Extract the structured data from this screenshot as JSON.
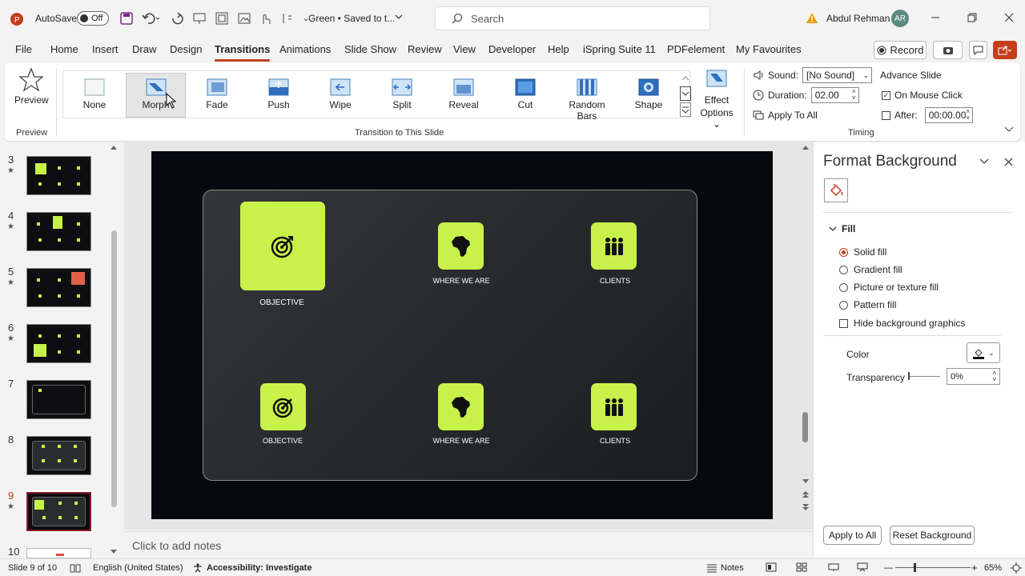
{
  "titlebar": {
    "autosave_label": "AutoSave",
    "autosave_state": "Off",
    "doc_title": "Green • Saved to t...",
    "search_placeholder": "Search",
    "user_name": "Abdul Rehman",
    "user_initials": "AR"
  },
  "tabs": [
    "File",
    "Home",
    "Insert",
    "Draw",
    "Design",
    "Transitions",
    "Animations",
    "Slide Show",
    "Review",
    "View",
    "Developer",
    "Help",
    "iSpring Suite 11",
    "PDFelement",
    "My Favourites"
  ],
  "active_tab": "Transitions",
  "record_label": "Record",
  "ribbon": {
    "preview_label": "Preview",
    "preview_group": "Preview",
    "transitions": [
      "None",
      "Morph",
      "Fade",
      "Push",
      "Wipe",
      "Split",
      "Reveal",
      "Cut",
      "Random Bars",
      "Shape"
    ],
    "selected_transition": "Morph",
    "effect_options_1": "Effect",
    "effect_options_2": "Options",
    "group_label": "Transition to This Slide",
    "sound_label": "Sound:",
    "sound_value": "[No Sound]",
    "duration_label": "Duration:",
    "duration_value": "02.00",
    "apply_all_label": "Apply To All",
    "advance_label": "Advance Slide",
    "on_mouse_click": "On Mouse Click",
    "after_label": "After:",
    "after_value": "00:00.00",
    "timing_group": "Timing"
  },
  "thumbnails": {
    "numbers": [
      "3",
      "4",
      "5",
      "6",
      "7",
      "8",
      "9",
      "10"
    ],
    "current": "9"
  },
  "slide": {
    "tiles": [
      "OBJECTIVE",
      "WHERE WE ARE",
      "CLIENTS",
      "OBJECTIVE",
      "WHERE WE ARE",
      "CLIENTS"
    ],
    "accent": "#c8f24a"
  },
  "notes_placeholder": "Click to add notes",
  "format_pane": {
    "title": "Format Background",
    "section": "Fill",
    "options": [
      "Solid fill",
      "Gradient fill",
      "Picture or texture fill",
      "Pattern fill"
    ],
    "selected": "Solid fill",
    "hide_graphics": "Hide background graphics",
    "color_label": "Color",
    "transparency_label": "Transparency",
    "transparency_value": "0%",
    "apply_all": "Apply to All",
    "reset": "Reset Background"
  },
  "status": {
    "slide_info": "Slide 9 of 10",
    "language": "English (United States)",
    "accessibility": "Accessibility: Investigate",
    "notes": "Notes",
    "zoom": "65%"
  }
}
